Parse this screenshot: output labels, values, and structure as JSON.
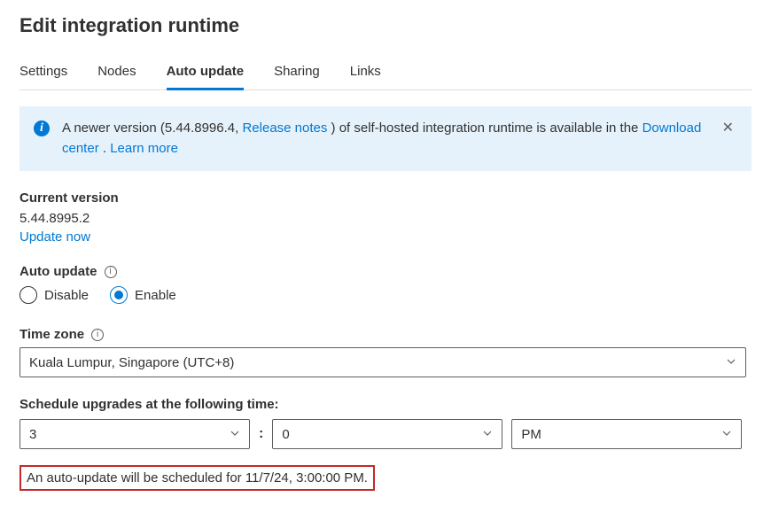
{
  "title": "Edit integration runtime",
  "tabs": [
    "Settings",
    "Nodes",
    "Auto update",
    "Sharing",
    "Links"
  ],
  "active_tab_index": 2,
  "banner": {
    "prefix": "A newer version (5.44.8996.4, ",
    "release_notes": "Release notes",
    "mid": " ) of self-hosted integration runtime is available in the ",
    "download_center": "Download center",
    "dot": " . ",
    "learn_more": "Learn more"
  },
  "current_version_label": "Current version",
  "current_version_value": "5.44.8995.2",
  "update_now": "Update now",
  "auto_update_label": "Auto update",
  "radio": {
    "disable": "Disable",
    "enable": "Enable"
  },
  "radio_selected": "enable",
  "time_zone_label": "Time zone",
  "time_zone_value": "Kuala Lumpur, Singapore (UTC+8)",
  "schedule_label": "Schedule upgrades at the following time:",
  "schedule": {
    "hour": "3",
    "minute": "0",
    "ampm": "PM"
  },
  "scheduled_message": "An auto-update will be scheduled for 11/7/24, 3:00:00 PM."
}
